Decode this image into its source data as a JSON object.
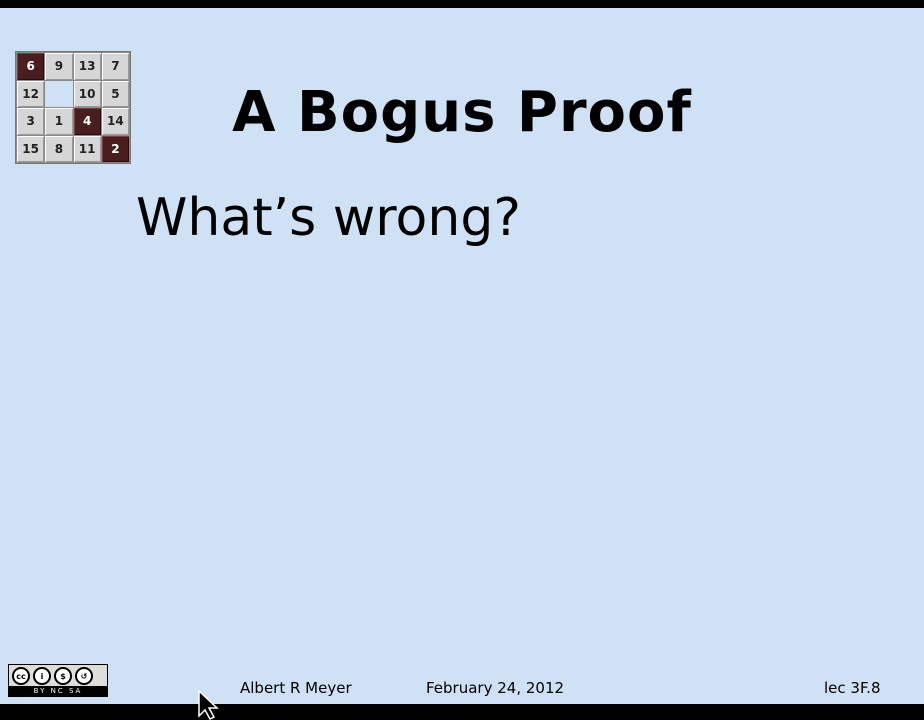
{
  "slide": {
    "title": "A Bogus Proof",
    "question": "What’s wrong?"
  },
  "puzzle": {
    "tiles": [
      "6",
      "9",
      "13",
      "7",
      "12",
      "",
      "10",
      "5",
      "3",
      "1",
      "4",
      "14",
      "15",
      "8",
      "11",
      "2"
    ],
    "dark_tiles": [
      "6",
      "4",
      "2"
    ]
  },
  "license": {
    "icon": "creative-commons-by-nc-sa-icon",
    "text": "BY NC SA"
  },
  "footer": {
    "author": "Albert R Meyer",
    "date": "February 24, 2012",
    "lecture": "lec 3F.8"
  },
  "colors": {
    "slide_bg": "#cfe2f5",
    "dark_tile": "#4a1e1e",
    "light_tile": "#d6d6d6"
  }
}
